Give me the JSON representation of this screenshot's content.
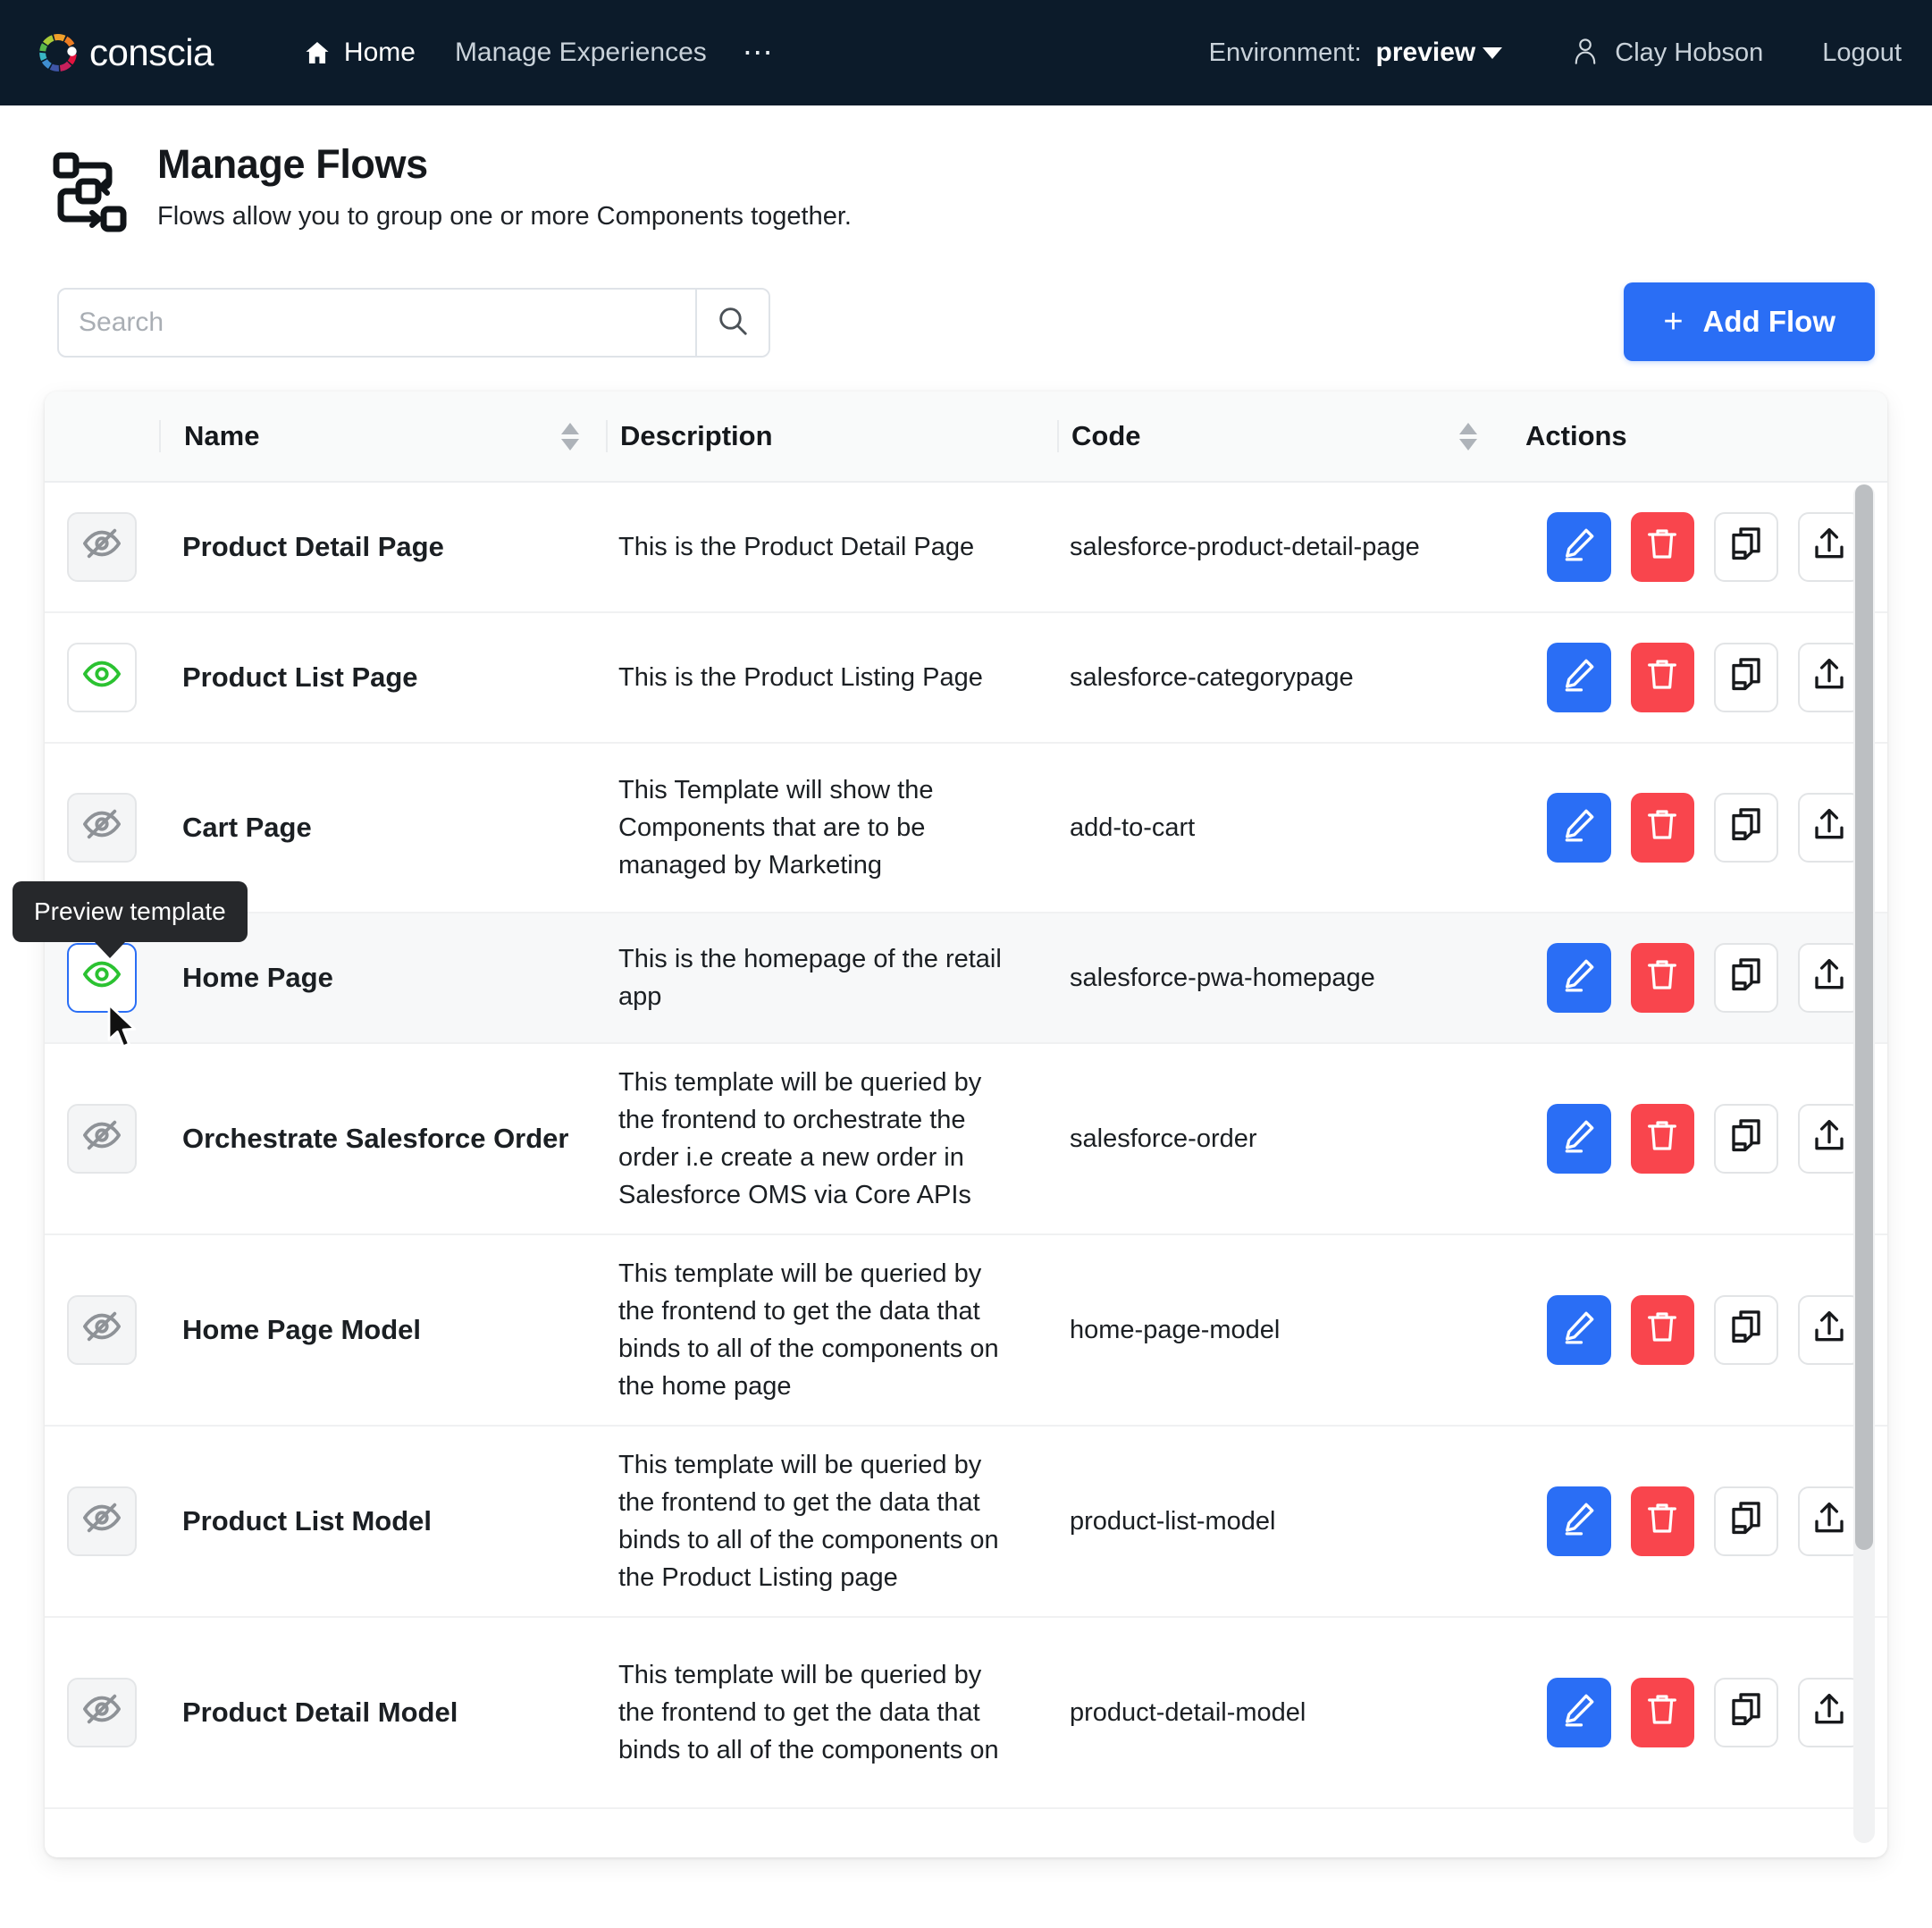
{
  "topbar": {
    "brand": "conscia",
    "nav": [
      {
        "label": "Home",
        "icon": "home-icon"
      },
      {
        "label": "Manage Experiences",
        "icon": ""
      }
    ],
    "overflow_label": "⋯",
    "environment_label": "Environment:",
    "environment_value": "preview",
    "user_name": "Clay Hobson",
    "logout_label": "Logout",
    "background": "#0c1b2a"
  },
  "page": {
    "title": "Manage Flows",
    "subtitle": "Flows allow you to group one or more Components together.",
    "icon": "flow-diagram-icon"
  },
  "toolbar": {
    "search_value": "",
    "search_placeholder": "Search",
    "search_icon": "search-icon",
    "add_flow_label": "Add Flow",
    "add_flow_plus": "+",
    "accent_color": "#2a6ef5"
  },
  "table": {
    "columns": [
      {
        "key": "eye",
        "label": "",
        "sortable": false
      },
      {
        "key": "name",
        "label": "Name",
        "sortable": true
      },
      {
        "key": "description",
        "label": "Description",
        "sortable": false
      },
      {
        "key": "code",
        "label": "Code",
        "sortable": true
      },
      {
        "key": "actions",
        "label": "Actions",
        "sortable": false
      }
    ],
    "action_buttons": [
      {
        "name": "edit",
        "icon": "pencil-icon",
        "color": "#2a6ef5"
      },
      {
        "name": "delete",
        "icon": "trash-icon",
        "color": "#f9454d"
      },
      {
        "name": "duplicate",
        "icon": "copy-icon",
        "color": "#ffffff"
      },
      {
        "name": "publish",
        "icon": "upload-icon",
        "color": "#ffffff"
      }
    ],
    "rows": [
      {
        "name": "Product Detail Page",
        "description": "This is the Product Detail Page",
        "code": "salesforce-product-detail-page",
        "preview_state": "hidden",
        "active": false
      },
      {
        "name": "Product List Page",
        "description": "This is the Product Listing Page",
        "code": "salesforce-categorypage",
        "preview_state": "visible",
        "active": false
      },
      {
        "name": "Cart Page",
        "description": "This Template will show the Components that are to be managed by Marketing",
        "code": "add-to-cart",
        "preview_state": "hidden",
        "active": false
      },
      {
        "name": "Home Page",
        "description": "This is the homepage of the retail app",
        "code": "salesforce-pwa-homepage",
        "preview_state": "visible",
        "active": true
      },
      {
        "name": "Orchestrate Salesforce Order",
        "description": "This template will be queried by the frontend to orchestrate the order i.e create a new order in Salesforce OMS via Core APIs",
        "code": "salesforce-order",
        "preview_state": "hidden",
        "active": false
      },
      {
        "name": "Home Page Model",
        "description": "This template will be queried by the frontend to get the data that binds to all of the components on the home page",
        "code": "home-page-model",
        "preview_state": "hidden",
        "active": false
      },
      {
        "name": "Product List Model",
        "description": "This template will be queried by the frontend to get the data that binds to all of the components on the Product Listing page",
        "code": "product-list-model",
        "preview_state": "hidden",
        "active": false
      },
      {
        "name": "Product Detail Model",
        "description": "This template will be queried by the frontend to get the data that binds to all of the components on",
        "code": "product-detail-model",
        "preview_state": "hidden",
        "active": false
      }
    ]
  },
  "tooltip": {
    "text": "Preview template"
  },
  "colors": {
    "eye_on": "#2bc231",
    "eye_off": "#8e9297",
    "focus_ring": "#2a6ef5",
    "danger": "#f9454d"
  }
}
